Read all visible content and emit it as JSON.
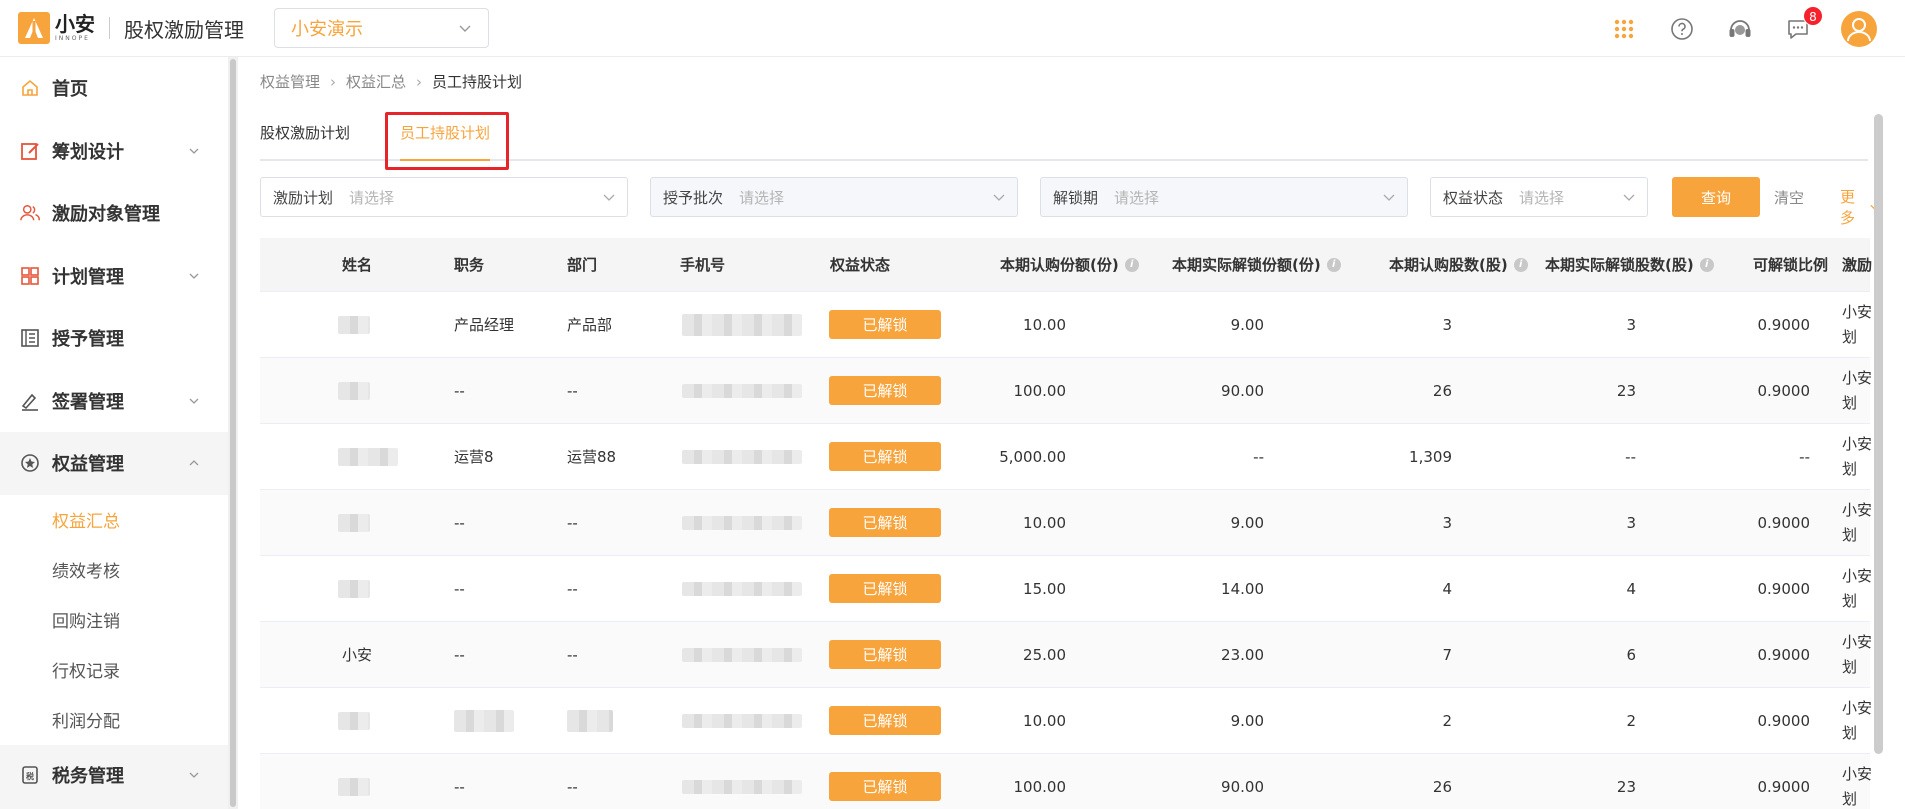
{
  "header": {
    "logo_text": "小安",
    "logo_sub": "INNOPE",
    "app_title": "股权激励管理",
    "company_select": "小安演示",
    "notification_count": "8",
    "icons": [
      "apps-grid-icon",
      "help-icon",
      "customer-service-icon",
      "message-icon",
      "user-avatar-icon"
    ],
    "accent_color": "#f7a43c"
  },
  "sidebar": {
    "items": [
      {
        "label": "首页",
        "icon": "home-icon"
      },
      {
        "label": "筹划设计",
        "icon": "design-icon",
        "expandable": true
      },
      {
        "label": "激励对象管理",
        "icon": "users-icon"
      },
      {
        "label": "计划管理",
        "icon": "plan-grid-icon",
        "expandable": true
      },
      {
        "label": "授予管理",
        "icon": "grant-book-icon"
      },
      {
        "label": "签署管理",
        "icon": "sign-icon",
        "expandable": true
      },
      {
        "label": "权益管理",
        "icon": "equity-icon",
        "expanded": true
      },
      {
        "label": "税务管理",
        "icon": "tax-icon",
        "expandable": true
      }
    ],
    "sub_items": [
      {
        "label": "权益汇总",
        "active": true
      },
      {
        "label": "绩效考核"
      },
      {
        "label": "回购注销"
      },
      {
        "label": "行权记录"
      },
      {
        "label": "利润分配"
      }
    ]
  },
  "breadcrumb": [
    "权益管理",
    "权益汇总",
    "员工持股计划"
  ],
  "tabs": [
    {
      "label": "股权激励计划"
    },
    {
      "label": "员工持股计划",
      "active": true
    }
  ],
  "filters": {
    "plan": {
      "label": "激励计划",
      "placeholder": "请选择"
    },
    "batch": {
      "label": "授予批次",
      "placeholder": "请选择"
    },
    "period": {
      "label": "解锁期",
      "placeholder": "请选择"
    },
    "status": {
      "label": "权益状态",
      "placeholder": "请选择"
    },
    "query_label": "查询",
    "clear_label": "清空",
    "more_label": "更多"
  },
  "table": {
    "columns": [
      "姓名",
      "职务",
      "部门",
      "手机号",
      "权益状态",
      "本期认购份额(份)",
      "本期实际解锁份额(份)",
      "本期认购股数(股)",
      "本期实际解锁股数(股)",
      "可解锁比例",
      "激励"
    ],
    "rows": [
      {
        "name": "",
        "position": "产品经理",
        "department": "产品部",
        "status": "已解锁",
        "shares_sub": "10.00",
        "shares_unlock": "9.00",
        "stock_sub": "3",
        "stock_unlock": "3",
        "ratio": "0.9000",
        "plan": "小安划"
      },
      {
        "name": "",
        "position": "--",
        "department": "--",
        "status": "已解锁",
        "shares_sub": "100.00",
        "shares_unlock": "90.00",
        "stock_sub": "26",
        "stock_unlock": "23",
        "ratio": "0.9000",
        "plan": "小安划"
      },
      {
        "name": "",
        "position": "运营8",
        "department": "运营88",
        "status": "已解锁",
        "shares_sub": "5,000.00",
        "shares_unlock": "--",
        "stock_sub": "1,309",
        "stock_unlock": "--",
        "ratio": "--",
        "plan": "小安划"
      },
      {
        "name": "",
        "position": "--",
        "department": "--",
        "status": "已解锁",
        "shares_sub": "10.00",
        "shares_unlock": "9.00",
        "stock_sub": "3",
        "stock_unlock": "3",
        "ratio": "0.9000",
        "plan": "小安划"
      },
      {
        "name": "",
        "position": "--",
        "department": "--",
        "status": "已解锁",
        "shares_sub": "15.00",
        "shares_unlock": "14.00",
        "stock_sub": "4",
        "stock_unlock": "4",
        "ratio": "0.9000",
        "plan": "小安划"
      },
      {
        "name": "小安",
        "position": "--",
        "department": "--",
        "status": "已解锁",
        "shares_sub": "25.00",
        "shares_unlock": "23.00",
        "stock_sub": "7",
        "stock_unlock": "6",
        "ratio": "0.9000",
        "plan": "小安划"
      },
      {
        "name": "",
        "position": "",
        "department": "",
        "status": "已解锁",
        "shares_sub": "10.00",
        "shares_unlock": "9.00",
        "stock_sub": "2",
        "stock_unlock": "2",
        "ratio": "0.9000",
        "plan": "小安划"
      },
      {
        "name": "",
        "position": "--",
        "department": "--",
        "status": "已解锁",
        "shares_sub": "100.00",
        "shares_unlock": "90.00",
        "stock_sub": "26",
        "stock_unlock": "23",
        "ratio": "0.9000",
        "plan": "小安划"
      }
    ]
  }
}
